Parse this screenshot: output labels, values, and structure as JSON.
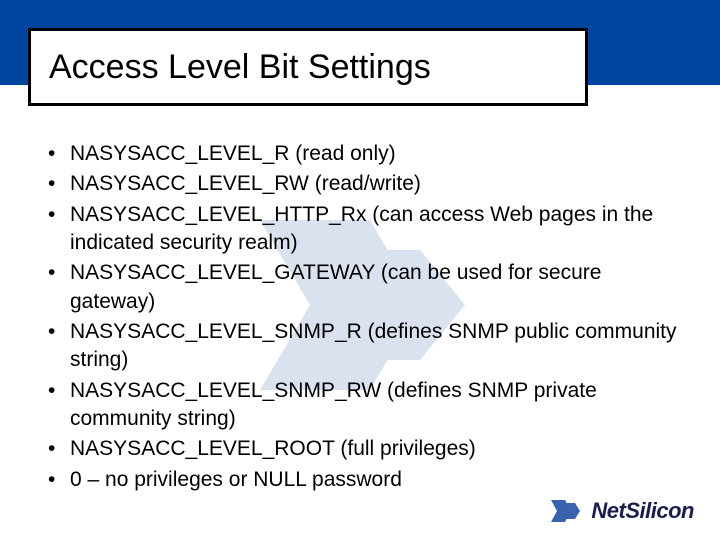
{
  "slide": {
    "title": "Access Level Bit Settings",
    "bullets": [
      "NASYSACC_LEVEL_R (read only)",
      "NASYSACC_LEVEL_RW (read/write)",
      "NASYSACC_LEVEL_HTTP_Rx (can access Web pages in the indicated security realm)",
      "NASYSACC_LEVEL_GATEWAY (can be used for secure gateway)",
      "NASYSACC_LEVEL_SNMP_R (defines SNMP public community string)",
      "NASYSACC_LEVEL_SNMP_RW (defines SNMP private community string)",
      "NASYSACC_LEVEL_ROOT (full privileges)",
      "0 – no privileges or NULL password"
    ]
  },
  "footer": {
    "brand": "NetSilicon"
  },
  "colors": {
    "header_blue": "#0045a0",
    "logo_blue": "#3a63ad"
  }
}
